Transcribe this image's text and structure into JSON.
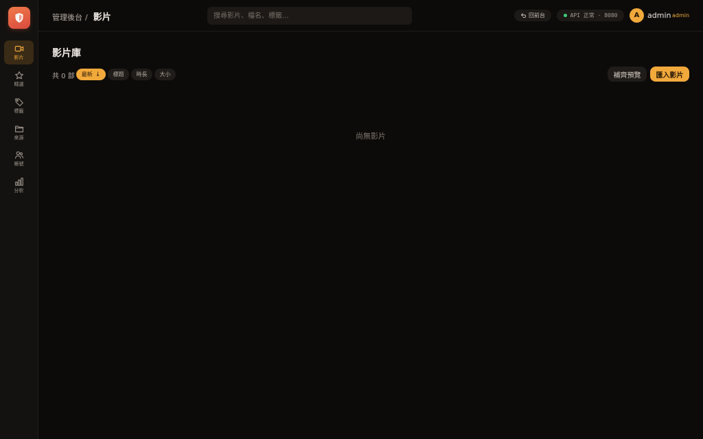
{
  "sidebar": {
    "items": [
      {
        "label": "影片",
        "icon": "video-icon",
        "active": true
      },
      {
        "label": "精選",
        "icon": "star-icon"
      },
      {
        "label": "標籤",
        "icon": "tag-icon"
      },
      {
        "label": "來源",
        "icon": "folder-icon"
      },
      {
        "label": "帳號",
        "icon": "users-icon"
      },
      {
        "label": "分析",
        "icon": "bar-chart-icon"
      }
    ]
  },
  "header": {
    "breadcrumb_parent": "管理後台",
    "breadcrumb_sep": "/",
    "breadcrumb_current": "影片",
    "search_placeholder": "搜尋影片、檔名、標籤...",
    "back_label": "回前台",
    "api_status": "API 正常 · 8080",
    "user_initial": "A",
    "user_name": "admin",
    "user_role": "admin"
  },
  "main": {
    "title": "影片庫",
    "count": "共 0 部",
    "sort_chips": [
      {
        "label": "最新",
        "arrow": "↓",
        "active": true
      },
      {
        "label": "標題"
      },
      {
        "label": "時長"
      },
      {
        "label": "大小"
      }
    ],
    "fill_preview_label": "補齊預覽",
    "import_label": "匯入影片",
    "empty_text": "尚無影片"
  },
  "colors": {
    "accent": "#f2a93b",
    "background": "#0d0b0a",
    "sidebar": "#141210",
    "status_ok": "#3ccf7a"
  }
}
